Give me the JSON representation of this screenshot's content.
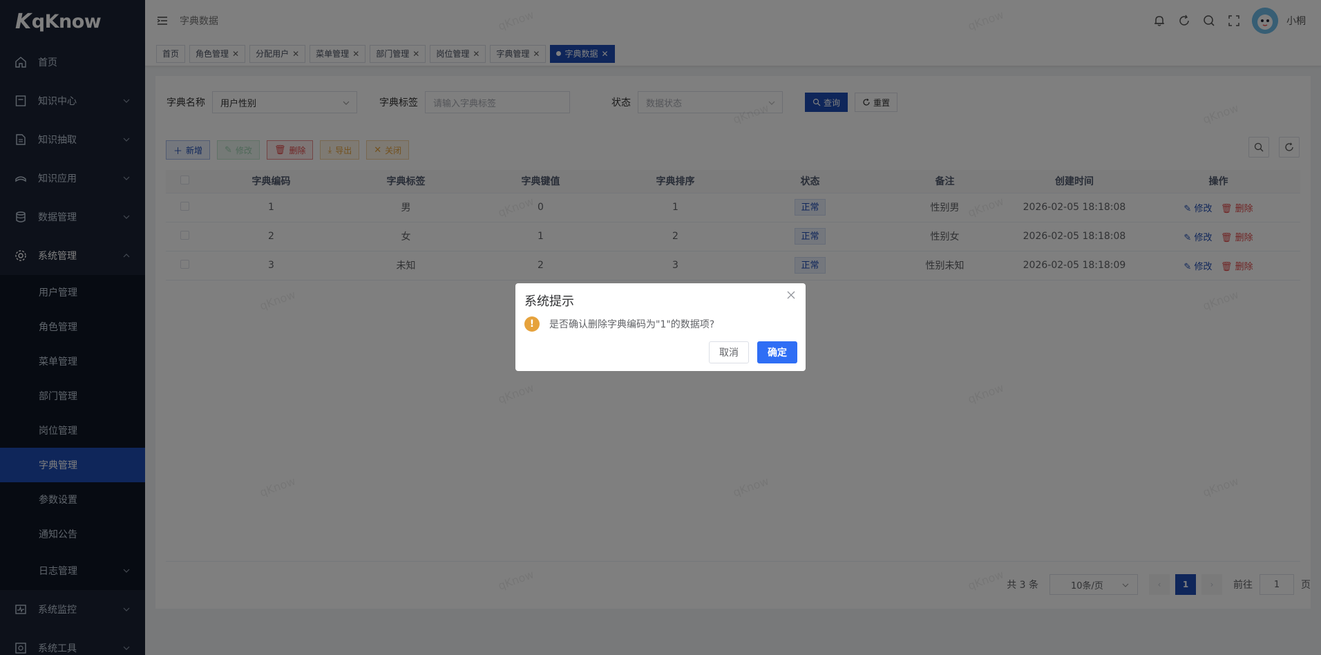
{
  "logo": {
    "mark": "K",
    "text": "qKnow"
  },
  "sidebar": {
    "items": [
      {
        "label": "首页",
        "icon": "home-icon"
      },
      {
        "label": "知识中心",
        "icon": "book-icon"
      },
      {
        "label": "知识抽取",
        "icon": "extract-icon"
      },
      {
        "label": "知识应用",
        "icon": "app-icon"
      },
      {
        "label": "数据管理",
        "icon": "database-icon"
      },
      {
        "label": "系统管理",
        "icon": "gear-icon"
      }
    ],
    "sub_items": [
      {
        "label": "用户管理"
      },
      {
        "label": "角色管理"
      },
      {
        "label": "菜单管理"
      },
      {
        "label": "部门管理"
      },
      {
        "label": "岗位管理"
      },
      {
        "label": "字典管理"
      },
      {
        "label": "参数设置"
      },
      {
        "label": "通知公告"
      },
      {
        "label": "日志管理"
      }
    ],
    "bottom_items": [
      {
        "label": "系统监控",
        "icon": "monitor-icon"
      },
      {
        "label": "系统工具",
        "icon": "tools-icon"
      }
    ]
  },
  "navbar": {
    "title": "字典数据",
    "username": "小桐"
  },
  "tags": [
    {
      "label": "首页"
    },
    {
      "label": "角色管理"
    },
    {
      "label": "分配用户"
    },
    {
      "label": "菜单管理"
    },
    {
      "label": "部门管理"
    },
    {
      "label": "岗位管理"
    },
    {
      "label": "字典管理"
    },
    {
      "label": "字典数据"
    }
  ],
  "search": {
    "dict_name_label": "字典名称",
    "dict_name_value": "用户性别",
    "dict_label_label": "字典标签",
    "dict_label_placeholder": "请输入字典标签",
    "status_label": "状态",
    "status_placeholder": "数据状态",
    "query_label": "查询",
    "reset_label": "重置"
  },
  "toolbar": {
    "add_label": "新增",
    "edit_label": "修改",
    "delete_label": "删除",
    "export_label": "导出",
    "close_label": "关闭"
  },
  "table": {
    "headers": [
      "字典编码",
      "字典标签",
      "字典键值",
      "字典排序",
      "状态",
      "备注",
      "创建时间",
      "操作"
    ],
    "rows": [
      {
        "code": "1",
        "label": "男",
        "value": "0",
        "sort": "1",
        "status": "正常",
        "remark": "性别男",
        "created": "2026-02-05 18:18:08"
      },
      {
        "code": "2",
        "label": "女",
        "value": "1",
        "sort": "2",
        "status": "正常",
        "remark": "性别女",
        "created": "2026-02-05 18:18:08"
      },
      {
        "code": "3",
        "label": "未知",
        "value": "2",
        "sort": "3",
        "status": "正常",
        "remark": "性别未知",
        "created": "2026-02-05 18:18:09"
      }
    ],
    "edit_action": "修改",
    "delete_action": "删除"
  },
  "pagination": {
    "total": "共 3 条",
    "page_size": "10条/页",
    "current_page": "1",
    "goto_label": "前往",
    "goto_value": "1",
    "page_suffix": "页"
  },
  "watermark": "qKnow",
  "dialog": {
    "title": "系统提示",
    "message": "是否确认删除字典编码为\"1\"的数据项?",
    "cancel_label": "取消",
    "confirm_label": "确定",
    "warn_symbol": "!"
  },
  "colors": {
    "sidebar_bg": "#1a2235",
    "primary": "#1f4db5",
    "confirm": "#2f6ef5",
    "danger": "#e04848",
    "warning": "#e6a23c"
  }
}
